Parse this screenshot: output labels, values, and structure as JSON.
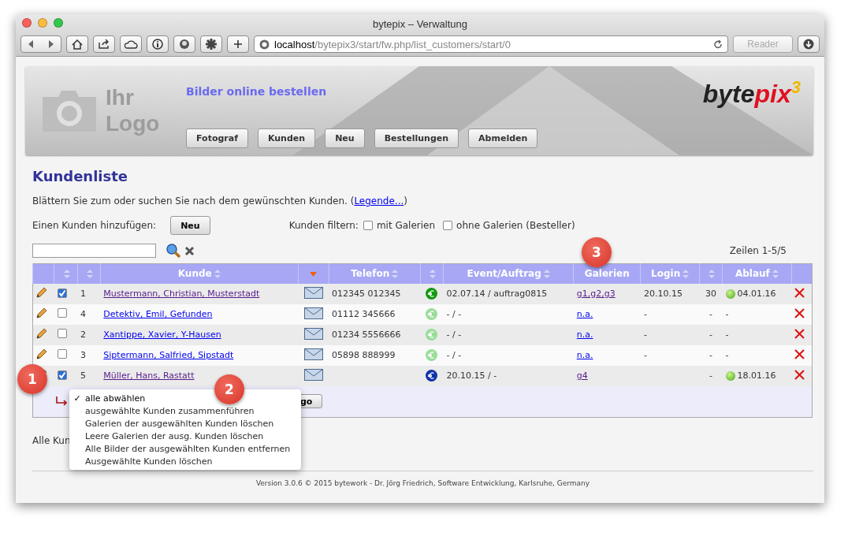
{
  "window": {
    "title": "bytepix – Verwaltung"
  },
  "browser": {
    "address_host": "localhost",
    "address_path": "/bytepix3/start/fw.php/list_customers/start/0",
    "reader": {
      "label": "Reader",
      "disabled": true
    }
  },
  "banner": {
    "logo_placeholder": [
      "Ihr",
      "Logo"
    ],
    "tagline": "Bilder online bestellen",
    "brand": {
      "main": "byte",
      "accent": "pix",
      "sup": "3"
    },
    "nav": [
      "Fotograf",
      "Kunden",
      "Neu",
      "Bestellungen",
      "Abmelden"
    ]
  },
  "page": {
    "title": "Kundenliste",
    "intro": "Blättern Sie zum oder suchen Sie nach dem gewünschten Kunden. (",
    "intro_link": "Legende...",
    "intro_end": ")",
    "add_label": "Einen Kunden hinzufügen:",
    "add_button": "Neu",
    "filter_label": "Kunden filtern:",
    "filters": [
      {
        "label": "mit Galerien",
        "checked": false
      },
      {
        "label": "ohne Galerien (Besteller)",
        "checked": false
      }
    ],
    "row_count": "Zeilen 1-5/5"
  },
  "table": {
    "columns": [
      {
        "sort_arrows": false,
        "sorted": false
      },
      {
        "sort_arrows": true,
        "sorted": false
      },
      {
        "sort_arrows": true,
        "sorted": false
      },
      {
        "label": "Kunde",
        "sort_arrows": true,
        "sorted": false
      },
      {
        "sort_arrows": false,
        "sorted": true
      },
      {
        "label": "Telefon",
        "sort_arrows": true,
        "sorted": false
      },
      {
        "sort_arrows": true,
        "sorted": false
      },
      {
        "label": "Event/Auftrag",
        "sort_arrows": true,
        "sorted": false
      },
      {
        "label": "Galerien",
        "sort_arrows": false,
        "sorted": false
      },
      {
        "label": "Login",
        "sort_arrows": true,
        "sorted": false
      },
      {
        "sort_arrows": true,
        "sorted": false
      },
      {
        "label": "Ablauf",
        "sort_arrows": true,
        "sorted": false
      },
      {
        "sort_arrows": false,
        "sorted": false
      }
    ],
    "rows": [
      {
        "checked": true,
        "nr": "1",
        "name": "Mustermann, Christian, Musterstadt",
        "visited": true,
        "phone": "012345 012345",
        "color": "#119911",
        "event": "02.07.14 / auftrag0815",
        "galleries": "g1,g2,g3",
        "login": "20.10.15",
        "count": "30",
        "expiry_dot": true,
        "expiry": "04.01.16"
      },
      {
        "checked": false,
        "nr": "4",
        "name": "Detektiv, Emil, Gefunden",
        "visited": false,
        "phone": "01112 345666",
        "color": "#99dd99",
        "event": "- / -",
        "galleries": "n.a.",
        "login": "-",
        "count": "-",
        "expiry_dot": false,
        "expiry": "-"
      },
      {
        "checked": false,
        "nr": "2",
        "name": "Xantippe, Xavier, Y-Hausen",
        "visited": false,
        "phone": "01234 5556666",
        "color": "#99dd99",
        "event": "- / -",
        "galleries": "n.a.",
        "login": "-",
        "count": "-",
        "expiry_dot": false,
        "expiry": "-"
      },
      {
        "checked": false,
        "nr": "3",
        "name": "Siptermann, Salfried, Sipstadt",
        "visited": false,
        "phone": "05898 888999",
        "color": "#99dd99",
        "event": "- / -",
        "galleries": "n.a.",
        "login": "-",
        "count": "-",
        "expiry_dot": false,
        "expiry": "-"
      },
      {
        "checked": true,
        "nr": "5",
        "name": "Müller, Hans, Rastatt",
        "visited": true,
        "color": "#1133aa",
        "event": "20.10.15 / -",
        "galleries": "g4",
        "count": "-",
        "expiry_dot": true,
        "expiry": "18.01.16"
      }
    ],
    "go_button": "go"
  },
  "menu": [
    {
      "label": "alle abwählen",
      "selected": true
    },
    {
      "label": "ausgewählte Kunden zusammenführen",
      "selected": false
    },
    {
      "label": "Galerien der ausgewählten Kunden löschen",
      "selected": false
    },
    {
      "label": "Leere Galerien der ausg. Kunden löschen",
      "selected": false
    },
    {
      "label": "Alle Bilder der ausgewählten Kunden entfernen",
      "selected": false
    },
    {
      "label": "Ausgewählte Kunden löschen",
      "selected": false
    }
  ],
  "check_mark": "✓",
  "partial_text": "Alle Kun",
  "footer": "Version 3.0.6 © 2015 bytework - Dr. Jörg Friedrich, Software Entwicklung, Karlsruhe, Germany",
  "callouts": [
    "1",
    "2",
    "3"
  ]
}
